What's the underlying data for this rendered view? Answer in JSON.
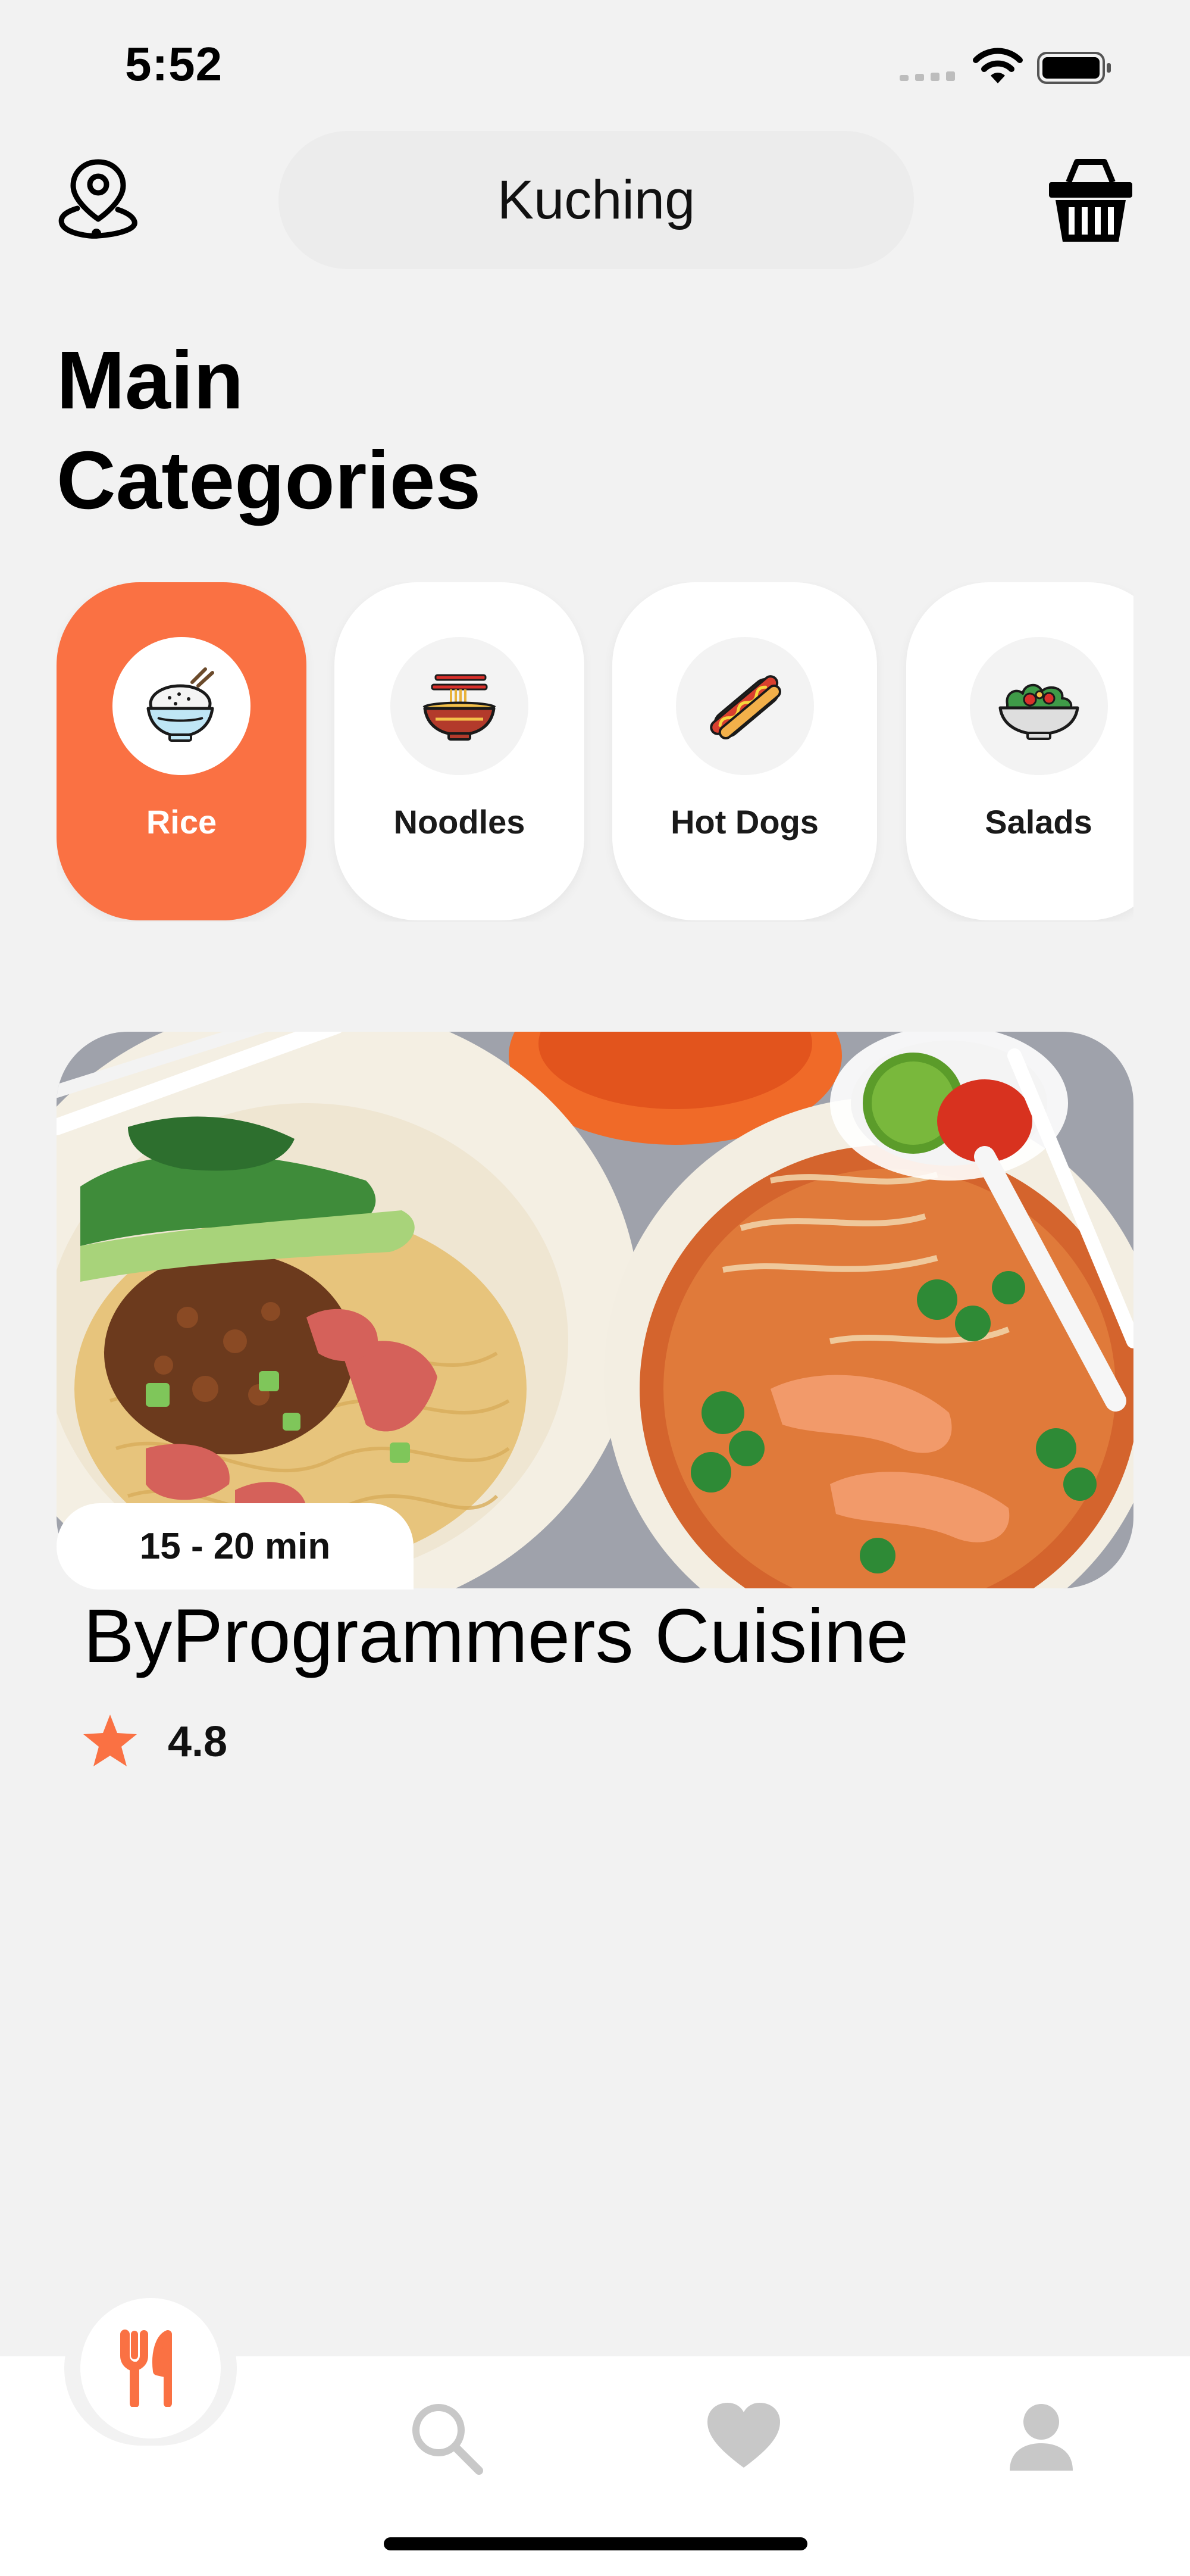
{
  "status_bar": {
    "time": "5:52"
  },
  "header": {
    "location": "Kuching"
  },
  "title": "Main\nCategories",
  "categories": [
    {
      "label": "Rice",
      "icon": "rice-bowl-icon",
      "active": true
    },
    {
      "label": "Noodles",
      "icon": "noodle-bowl-icon",
      "active": false
    },
    {
      "label": "Hot Dogs",
      "icon": "hot-dog-icon",
      "active": false
    },
    {
      "label": "Salads",
      "icon": "salad-bowl-icon",
      "active": false
    }
  ],
  "restaurant": {
    "delivery_time": "15 - 20 min",
    "name": "ByProgrammers Cuisine",
    "rating": "4.8"
  },
  "nav": [
    {
      "icon": "fork-knife-icon",
      "active": true
    },
    {
      "icon": "search-icon",
      "active": false
    },
    {
      "icon": "heart-icon",
      "active": false
    },
    {
      "icon": "user-icon",
      "active": false
    }
  ],
  "colors": {
    "accent": "#fa7143",
    "background": "#f2f2f2",
    "inactive_icon": "#c8c8c8"
  }
}
